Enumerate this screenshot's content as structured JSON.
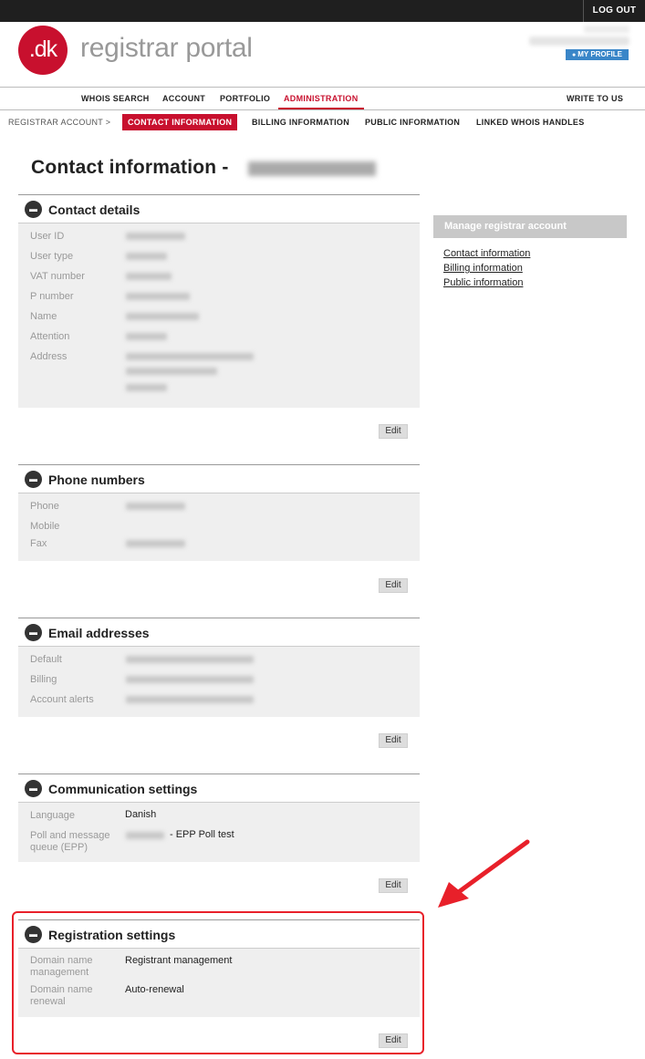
{
  "topbar": {
    "logout_label": "LOG OUT"
  },
  "header": {
    "logo_text": ".dk",
    "portal_title": "registrar portal",
    "profile_label": "MY PROFILE"
  },
  "mainnav": {
    "items": [
      "WHOIS SEARCH",
      "ACCOUNT",
      "PORTFOLIO",
      "ADMINISTRATION"
    ],
    "right_item": "WRITE TO US"
  },
  "subnav": {
    "breadcrumb": "REGISTRAR ACCOUNT >",
    "items": [
      "CONTACT INFORMATION",
      "BILLING INFORMATION",
      "PUBLIC INFORMATION",
      "LINKED WHOIS HANDLES"
    ]
  },
  "page": {
    "title": "Contact information -"
  },
  "sections": {
    "contact": {
      "title": "Contact details",
      "fields": [
        "User ID",
        "User type",
        "VAT number",
        "P number",
        "Name",
        "Attention",
        "Address"
      ]
    },
    "phone": {
      "title": "Phone numbers",
      "fields": [
        "Phone",
        "Mobile",
        "Fax"
      ]
    },
    "email": {
      "title": "Email addresses",
      "fields": [
        "Default",
        "Billing",
        "Account alerts"
      ]
    },
    "communication": {
      "title": "Communication settings",
      "fields": [
        {
          "label": "Language",
          "value": "Danish"
        },
        {
          "label": "Poll and message queue (EPP)",
          "value": "- EPP Poll test"
        }
      ]
    },
    "registration": {
      "title": "Registration settings",
      "fields": [
        {
          "label": "Domain name management",
          "value": "Registrant management"
        },
        {
          "label": "Domain name renewal",
          "value": "Auto-renewal"
        }
      ]
    },
    "edit_label": "Edit"
  },
  "sidebar": {
    "heading": "Manage registrar account",
    "links": [
      "Contact information",
      "Billing information",
      "Public information"
    ]
  },
  "colors": {
    "brand_red": "#c8102e",
    "profile_blue": "#3a86c8",
    "annotation_red": "#e8202a"
  }
}
